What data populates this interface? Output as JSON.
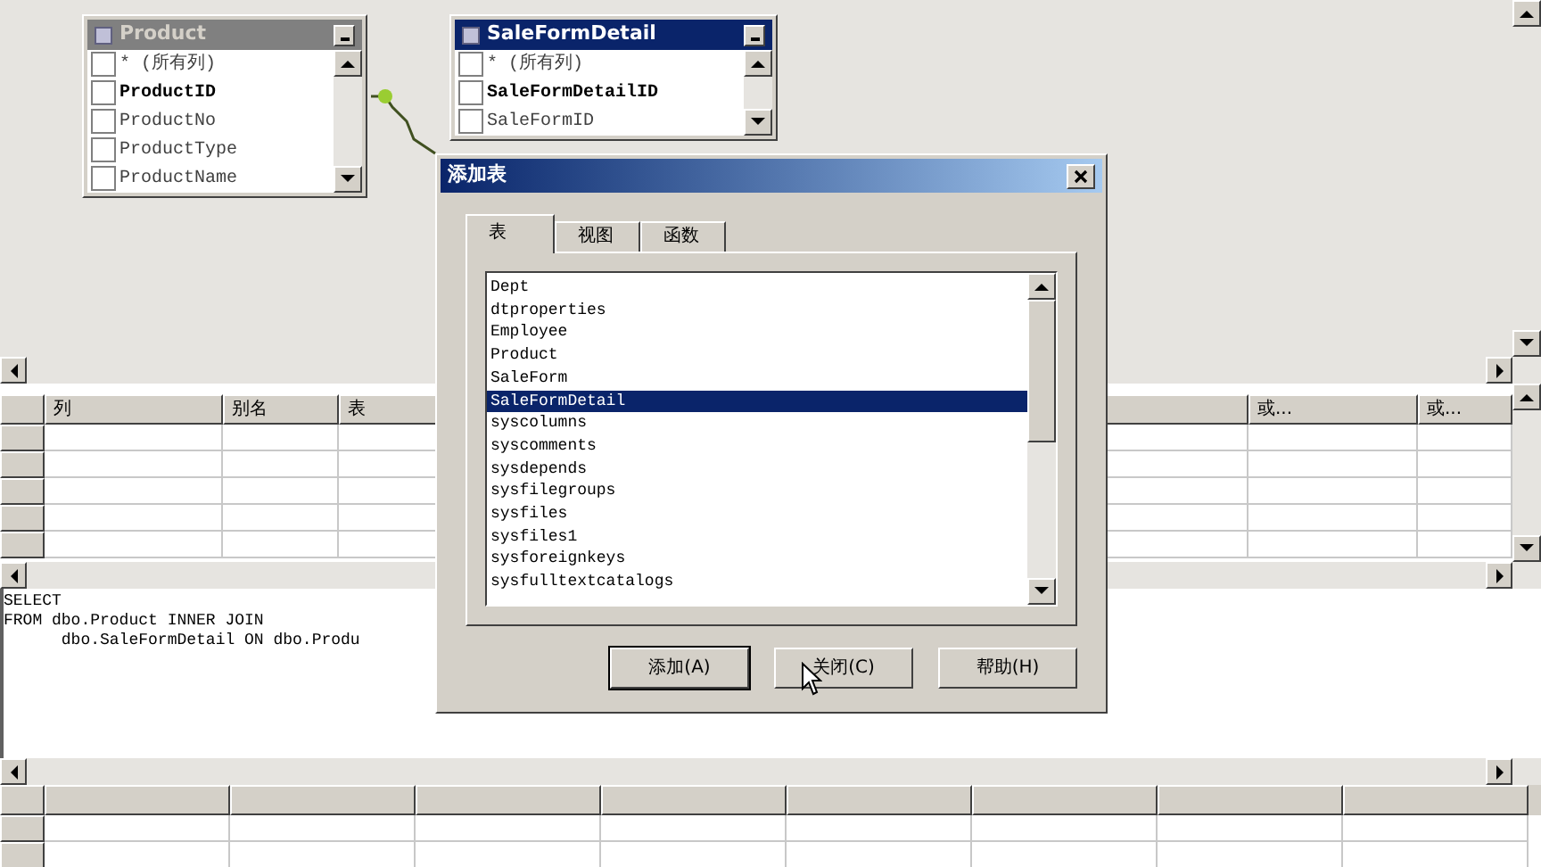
{
  "diagram": {
    "tables": [
      {
        "title": "Product",
        "active": false,
        "columns": [
          {
            "name": "* (所有列)",
            "key": false,
            "checked": false
          },
          {
            "name": "ProductID",
            "key": true,
            "checked": false
          },
          {
            "name": "ProductNo",
            "key": false,
            "checked": false
          },
          {
            "name": "ProductType",
            "key": false,
            "checked": false
          },
          {
            "name": "ProductName",
            "key": false,
            "checked": false
          }
        ]
      },
      {
        "title": "SaleFormDetail",
        "active": true,
        "columns": [
          {
            "name": "* (所有列)",
            "key": false,
            "checked": false
          },
          {
            "name": "SaleFormDetailID",
            "key": true,
            "checked": false
          },
          {
            "name": "SaleFormID",
            "key": false,
            "checked": false
          }
        ]
      }
    ]
  },
  "grid": {
    "columns": [
      "列",
      "别名",
      "表",
      "",
      "或...",
      "或..."
    ]
  },
  "sql": {
    "lines": [
      "SELECT",
      "FROM dbo.Product INNER JOIN",
      "      dbo.SaleFormDetail ON dbo.Produ"
    ]
  },
  "dialog": {
    "title": "添加表",
    "tabs": [
      {
        "label": "表",
        "selected": true
      },
      {
        "label": "视图",
        "selected": false
      },
      {
        "label": "函数",
        "selected": false
      }
    ],
    "items": [
      {
        "label": "Dept",
        "selected": false
      },
      {
        "label": "dtproperties",
        "selected": false
      },
      {
        "label": "Employee",
        "selected": false
      },
      {
        "label": "Product",
        "selected": false
      },
      {
        "label": "SaleForm",
        "selected": false
      },
      {
        "label": "SaleFormDetail",
        "selected": true
      },
      {
        "label": "syscolumns",
        "selected": false
      },
      {
        "label": "syscomments",
        "selected": false
      },
      {
        "label": "sysdepends",
        "selected": false
      },
      {
        "label": "sysfilegroups",
        "selected": false
      },
      {
        "label": "sysfiles",
        "selected": false
      },
      {
        "label": "sysfiles1",
        "selected": false
      },
      {
        "label": "sysforeignkeys",
        "selected": false
      },
      {
        "label": "sysfulltextcatalogs",
        "selected": false
      }
    ],
    "buttons": [
      {
        "label": "添加(A)",
        "default": true
      },
      {
        "label": "关闭(C)",
        "default": false
      },
      {
        "label": "帮助(H)",
        "default": false
      }
    ]
  }
}
